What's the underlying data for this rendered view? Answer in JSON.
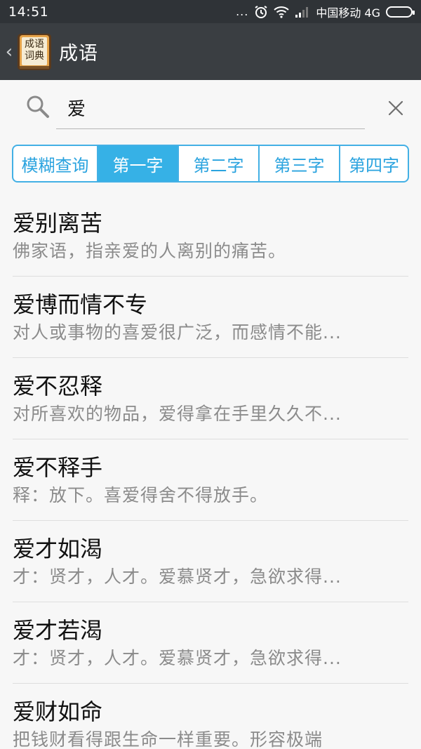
{
  "status_bar": {
    "time": "14:51",
    "dots": "...",
    "carrier": "中国移动 4G"
  },
  "action_bar": {
    "back_glyph": "‹",
    "logo_text_top": "成语",
    "logo_text_bottom": "词典",
    "title": "成语"
  },
  "search": {
    "value": "爱",
    "placeholder": ""
  },
  "tabs": [
    {
      "label": "模糊查询",
      "active": false
    },
    {
      "label": "第一字",
      "active": true
    },
    {
      "label": "第二字",
      "active": false
    },
    {
      "label": "第三字",
      "active": false
    },
    {
      "label": "第四字",
      "active": false
    }
  ],
  "results": [
    {
      "title": "爱别离苦",
      "desc": "佛家语，指亲爱的人离别的痛苦。"
    },
    {
      "title": "爱博而情不专",
      "desc": "对人或事物的喜爱很广泛，而感情不能..."
    },
    {
      "title": "爱不忍释",
      "desc": "对所喜欢的物品，爱得拿在手里久久不..."
    },
    {
      "title": "爱不释手",
      "desc": "释：放下。喜爱得舍不得放手。"
    },
    {
      "title": "爱才如渴",
      "desc": "才：贤才，人才。爱慕贤才，急欲求得..."
    },
    {
      "title": "爱才若渴",
      "desc": "才：贤才，人才。爱慕贤才，急欲求得..."
    },
    {
      "title": "爱财如命",
      "desc": "把钱财看得跟生命一样重要。形容极端"
    }
  ],
  "colors": {
    "accent": "#36b1e6",
    "action_bar": "#3a3e42",
    "status_bar": "#2f3337"
  }
}
